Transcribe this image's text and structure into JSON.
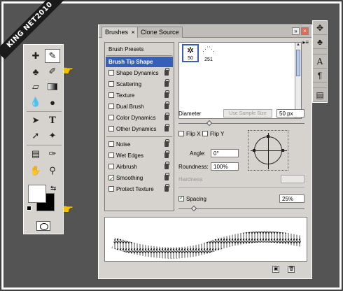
{
  "watermark": {
    "text": "KING NET2010"
  },
  "tools": {
    "items": [
      {
        "name": "spot-healing-tool",
        "glyph": "✚"
      },
      {
        "name": "brush-tool",
        "glyph": "✎",
        "active": true
      },
      {
        "name": "clone-stamp-tool",
        "glyph": "♣"
      },
      {
        "name": "history-brush-tool",
        "glyph": "✐"
      },
      {
        "name": "eraser-tool",
        "glyph": "▱"
      },
      {
        "name": "gradient-tool",
        "glyph": "▮"
      },
      {
        "name": "blur-tool",
        "glyph": "●"
      },
      {
        "name": "dodge-tool",
        "glyph": "◐"
      },
      {
        "name": "path-selection-tool",
        "glyph": "➤"
      },
      {
        "name": "type-tool",
        "glyph": "T"
      },
      {
        "name": "direct-selection-tool",
        "glyph": "➚"
      },
      {
        "name": "custom-shape-tool",
        "glyph": "✦"
      },
      {
        "name": "notes-tool",
        "glyph": "✉"
      },
      {
        "name": "eyedropper-tool",
        "glyph": "✑"
      },
      {
        "name": "hand-tool",
        "glyph": "✋"
      },
      {
        "name": "zoom-tool",
        "glyph": "⚲"
      }
    ]
  },
  "brushes_panel": {
    "tabs": [
      "Brushes",
      "Clone Source"
    ],
    "tab_close": "×",
    "presets_label": "Brush Presets",
    "options": [
      {
        "label": "Brush Tip Shape",
        "checkbox": false,
        "selected": true,
        "lock": false
      },
      {
        "label": "Shape Dynamics",
        "checkbox": true,
        "checked": false,
        "lock": true
      },
      {
        "label": "Scattering",
        "checkbox": true,
        "checked": false,
        "lock": true
      },
      {
        "label": "Texture",
        "checkbox": true,
        "checked": false,
        "lock": true
      },
      {
        "label": "Dual Brush",
        "checkbox": true,
        "checked": false,
        "lock": true
      },
      {
        "label": "Color Dynamics",
        "checkbox": true,
        "checked": false,
        "lock": true
      },
      {
        "label": "Other Dynamics",
        "checkbox": true,
        "checked": false,
        "lock": true
      },
      {
        "label": "Noise",
        "checkbox": true,
        "checked": false,
        "lock": true
      },
      {
        "label": "Wet Edges",
        "checkbox": true,
        "checked": false,
        "lock": true
      },
      {
        "label": "Airbrush",
        "checkbox": true,
        "checked": false,
        "lock": true
      },
      {
        "label": "Smoothing",
        "checkbox": true,
        "checked": true,
        "lock": true
      },
      {
        "label": "Protect Texture",
        "checkbox": true,
        "checked": false,
        "lock": true
      }
    ],
    "thumbnails": [
      {
        "size": "50",
        "selected": true
      },
      {
        "size": "251",
        "selected": false
      }
    ],
    "diameter": {
      "label": "Diameter",
      "sample_button": "Use Sample Size",
      "value": "50 px"
    },
    "flip_x": {
      "label": "Flip X",
      "checked": false
    },
    "flip_y": {
      "label": "Flip Y",
      "checked": false
    },
    "angle": {
      "label": "Angle:",
      "value": "0°"
    },
    "roundness": {
      "label": "Roundness:",
      "value": "100%"
    },
    "hardness": {
      "label": "Hardness",
      "value": ""
    },
    "spacing": {
      "label": "Spacing",
      "checked": true,
      "value": "25%"
    }
  },
  "dock": {
    "buttons": [
      "brushes-dock-icon",
      "clone-source-dock-icon",
      "character-dock-icon",
      "paragraph-dock-icon",
      "notes-dock-icon"
    ]
  },
  "colors": {
    "selection_blue": "#3660b8",
    "panel_gray": "#d6d3ce",
    "hand_yellow": "#f2c200"
  }
}
